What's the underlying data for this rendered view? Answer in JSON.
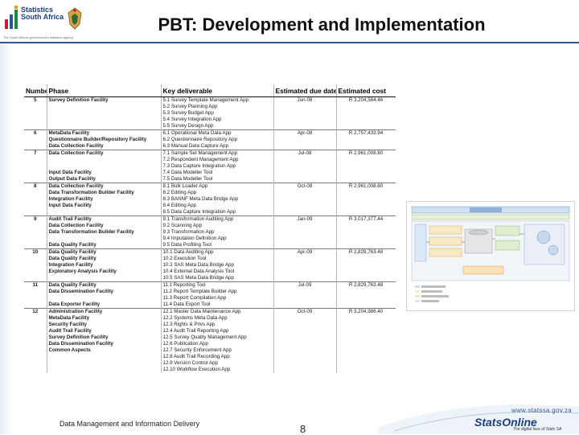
{
  "logo": {
    "line1": "Statistics",
    "line2": "South Africa",
    "tagline": "The South African government's statistics agency"
  },
  "title": "PBT: Development and Implementation",
  "table": {
    "headers": {
      "number": "Number",
      "phase": "Phase",
      "deliverable": "Key deliverable",
      "due": "Estimated due date",
      "cost": "Estimated cost"
    },
    "rows": [
      {
        "n": "5",
        "p": "Survey Definition Facility",
        "d": "5.1 Survey Template Management App",
        "t": "Jun-08",
        "c": "R 3,204,584.46"
      },
      {
        "n": "",
        "p": "",
        "d": "5.2 Survey Planning App",
        "t": "",
        "c": ""
      },
      {
        "n": "",
        "p": "",
        "d": "5.3 Survey Budget App",
        "t": "",
        "c": ""
      },
      {
        "n": "",
        "p": "",
        "d": "5.4 Survey Integration App",
        "t": "",
        "c": ""
      },
      {
        "n": "",
        "p": "",
        "d": "5.5 Survey Design App",
        "t": "",
        "c": ""
      },
      {
        "n": "6",
        "p": "MetaData Facility",
        "d": "6.1 Operational Meta Data App",
        "t": "Apr-08",
        "c": "R 2,757,433.94"
      },
      {
        "n": "",
        "p": "Questionnaire Builder/Repository Facility",
        "d": "6.2 Questionnaire Repository App",
        "t": "",
        "c": ""
      },
      {
        "n": "",
        "p": "Data Collection Facility",
        "d": "6.3 Manual Data Capture App",
        "t": "",
        "c": ""
      },
      {
        "n": "7",
        "p": "Data Collection Facility",
        "d": "7.1 Sample Set Management App",
        "t": "Jul-08",
        "c": "R 2,961,008.80"
      },
      {
        "n": "",
        "p": "",
        "d": "7.2 Respondent Management App",
        "t": "",
        "c": ""
      },
      {
        "n": "",
        "p": "",
        "d": "7.3 Data Capture Integration App",
        "t": "",
        "c": ""
      },
      {
        "n": "",
        "p": "Input Data Facility",
        "d": "7.4 Data Modeller Tool",
        "t": "",
        "c": ""
      },
      {
        "n": "",
        "p": "Output Data Facility",
        "d": "7.5 Data Modeller Tool",
        "t": "",
        "c": ""
      },
      {
        "n": "8",
        "p": "Data Collection Facility",
        "d": "8.1 Bulk Loader App",
        "t": "Oct-08",
        "c": "R 2,961,008.80"
      },
      {
        "n": "",
        "p": "Data Transformation Builder Facility",
        "d": "8.2 Editing App",
        "t": "",
        "c": ""
      },
      {
        "n": "",
        "p": "Integration Facility",
        "d": "8.3 BANNF Meta Data Bridge App",
        "t": "",
        "c": ""
      },
      {
        "n": "",
        "p": "Input Data Facility",
        "d": "8.4 Editing App",
        "t": "",
        "c": ""
      },
      {
        "n": "",
        "p": "",
        "d": "8.5 Data Capture Integration App",
        "t": "",
        "c": ""
      },
      {
        "n": "9",
        "p": "Audit Trail Facility",
        "d": "9.1 Transformation Auditing App",
        "t": "Jan-09",
        "c": "R 3,017,377.44"
      },
      {
        "n": "",
        "p": "Data Collection Facility",
        "d": "9.2 Scanning App",
        "t": "",
        "c": ""
      },
      {
        "n": "",
        "p": "Data Transformation Builder Facility",
        "d": "9.3 Transformation App",
        "t": "",
        "c": ""
      },
      {
        "n": "",
        "p": "",
        "d": "9.4 Imputation Definition App",
        "t": "",
        "c": ""
      },
      {
        "n": "",
        "p": "Data Quality Facility",
        "d": "9.5 Data Profiling Tool",
        "t": "",
        "c": ""
      },
      {
        "n": "10",
        "p": "Data Quality Facility",
        "d": "10.1 Data Auditing App",
        "t": "Apr-09",
        "c": "R 2,829,763.48"
      },
      {
        "n": "",
        "p": "Data Quality Facility",
        "d": "10.2 Execution Tool",
        "t": "",
        "c": ""
      },
      {
        "n": "",
        "p": "Integration Facility",
        "d": "10.3 SAS Meta Data Bridge App",
        "t": "",
        "c": ""
      },
      {
        "n": "",
        "p": "Exploratory Analysis Facility",
        "d": "10.4 External Data Analysis Tool",
        "t": "",
        "c": ""
      },
      {
        "n": "",
        "p": "",
        "d": "10.5 SAS Meta Data Bridge App",
        "t": "",
        "c": ""
      },
      {
        "n": "11",
        "p": "Data Quality Facility",
        "d": "11.1 Reporting Tool",
        "t": "Jul-09",
        "c": "R 2,829,763.48"
      },
      {
        "n": "",
        "p": "Data Dissemination Facility",
        "d": "11.2 Report Template Builder App",
        "t": "",
        "c": ""
      },
      {
        "n": "",
        "p": "",
        "d": "11.3 Report Compilation App",
        "t": "",
        "c": ""
      },
      {
        "n": "",
        "p": "Data Exporter Facility",
        "d": "11.4 Data Export Tool",
        "t": "",
        "c": ""
      },
      {
        "n": "12",
        "p": "Administration Facility",
        "d": "12.1 Master Data Maintenance App",
        "t": "Oct-09",
        "c": "R 3,204,986.40"
      },
      {
        "n": "",
        "p": "MetaData Facility",
        "d": "12.2 Systems Meta Data App",
        "t": "",
        "c": ""
      },
      {
        "n": "",
        "p": "Security Facility",
        "d": "12.3 Rights & Privs App",
        "t": "",
        "c": ""
      },
      {
        "n": "",
        "p": "Audit Trail Facility",
        "d": "12.4 Audit Trail Reporting App",
        "t": "",
        "c": ""
      },
      {
        "n": "",
        "p": "Survey Definition Facility",
        "d": "12.5 Survey Quality Management App",
        "t": "",
        "c": ""
      },
      {
        "n": "",
        "p": "Data Dissemination Facility",
        "d": "12.6 Publication App",
        "t": "",
        "c": ""
      },
      {
        "n": "",
        "p": "Common Aspects",
        "d": "12.7 Security Enforcement App",
        "t": "",
        "c": ""
      },
      {
        "n": "",
        "p": "",
        "d": "12.8 Audit Trail Recording App",
        "t": "",
        "c": ""
      },
      {
        "n": "",
        "p": "",
        "d": "12.9 Version Control App",
        "t": "",
        "c": ""
      },
      {
        "n": "",
        "p": "",
        "d": "12.10 Workflow Execution App",
        "t": "",
        "c": ""
      }
    ]
  },
  "footer": {
    "text": "Data Management and Information Delivery",
    "page": "8"
  },
  "brand": {
    "website": "www.statssa.gov.za",
    "name": "StatsOnline",
    "tagline": "The digital face of Stats SA"
  },
  "colors": {
    "accent": "#2e5597",
    "brand": "#1c3f7a"
  }
}
